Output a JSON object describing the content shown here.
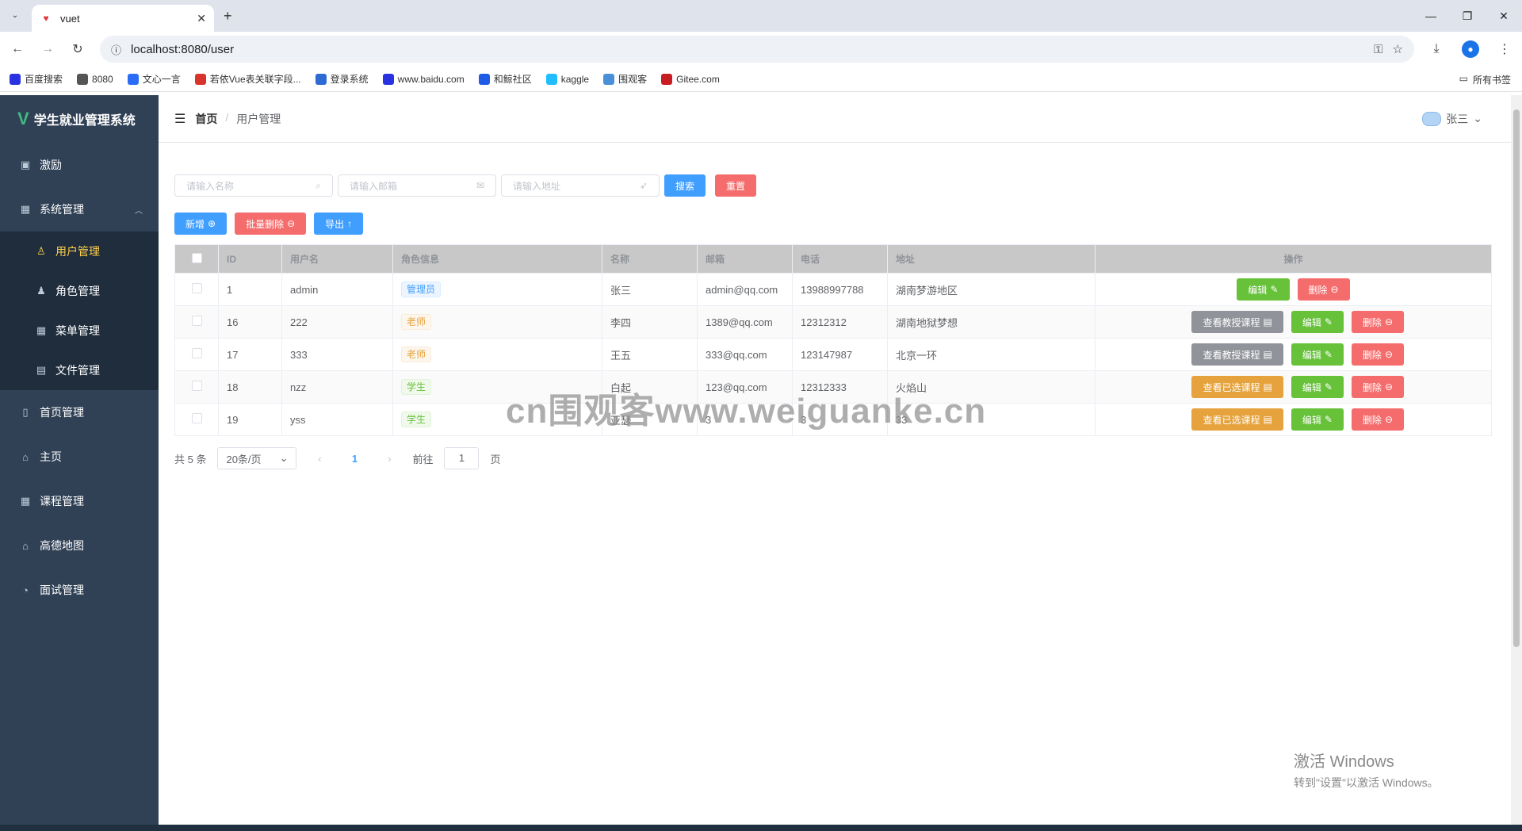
{
  "browser": {
    "tab_title": "vuet",
    "url": "localhost:8080/user",
    "bookmarks": [
      {
        "label": "百度搜索",
        "icon": "baidu-icon",
        "color": "#2932e1"
      },
      {
        "label": "8080",
        "icon": "globe-icon",
        "color": "#555555"
      },
      {
        "label": "文心一言",
        "icon": "wenxin-icon",
        "color": "#2a6cf6"
      },
      {
        "label": "若依Vue表关联字段...",
        "icon": "jian-icon",
        "color": "#d9342b"
      },
      {
        "label": "登录系统",
        "icon": "login-icon",
        "color": "#2d6bd2"
      },
      {
        "label": "www.baidu.com",
        "icon": "baidu-icon",
        "color": "#2932e1"
      },
      {
        "label": "和鲸社区",
        "icon": "heywhale-icon",
        "color": "#1e5ce6"
      },
      {
        "label": "kaggle",
        "icon": "kaggle-icon",
        "color": "#20beff"
      },
      {
        "label": "围观客",
        "icon": "weiguanke-icon",
        "color": "#4a90d9"
      },
      {
        "label": "Gitee.com",
        "icon": "gitee-icon",
        "color": "#c71d23"
      }
    ],
    "all_bookmarks": "所有书签"
  },
  "sidebar": {
    "title": "学生就业管理系统",
    "items": [
      {
        "label": "激励",
        "icon": "chart-icon"
      },
      {
        "label": "系统管理",
        "icon": "grid-icon"
      },
      {
        "label": "用户管理",
        "icon": "user-icon"
      },
      {
        "label": "角色管理",
        "icon": "role-icon"
      },
      {
        "label": "菜单管理",
        "icon": "menu-icon"
      },
      {
        "label": "文件管理",
        "icon": "file-icon"
      },
      {
        "label": "首页管理",
        "icon": "trash-icon"
      },
      {
        "label": "主页",
        "icon": "home-icon"
      },
      {
        "label": "课程管理",
        "icon": "grid-icon"
      },
      {
        "label": "高德地图",
        "icon": "home-icon"
      },
      {
        "label": "面试管理",
        "icon": "trend-icon"
      }
    ]
  },
  "header": {
    "breadcrumb_home": "首页",
    "breadcrumb_current": "用户管理",
    "username": "张三"
  },
  "search": {
    "name_placeholder": "请输入名称",
    "email_placeholder": "请输入邮箱",
    "address_placeholder": "请输入地址",
    "search_label": "搜索",
    "reset_label": "重置"
  },
  "actions": {
    "add_label": "新增",
    "batch_delete_label": "批量删除",
    "export_label": "导出"
  },
  "table": {
    "columns": [
      "ID",
      "用户名",
      "角色信息",
      "名称",
      "邮箱",
      "电话",
      "地址",
      "操作"
    ],
    "rows": [
      {
        "id": "1",
        "username": "admin",
        "role": "管理员",
        "name": "张三",
        "email": "admin@qq.com",
        "phone": "13988997788",
        "address": "湖南梦游地区",
        "course_btn": ""
      },
      {
        "id": "16",
        "username": "222",
        "role": "老师",
        "name": "李四",
        "email": "1389@qq.com",
        "phone": "12312312",
        "address": "湖南地狱梦想",
        "course_btn": "查看教授课程"
      },
      {
        "id": "17",
        "username": "333",
        "role": "老师",
        "name": "王五",
        "email": "333@qq.com",
        "phone": "123147987",
        "address": "北京一环",
        "course_btn": "查看教授课程"
      },
      {
        "id": "18",
        "username": "nzz",
        "role": "学生",
        "name": "白起",
        "email": "123@qq.com",
        "phone": "12312333",
        "address": "火焰山",
        "course_btn": "查看已选课程"
      },
      {
        "id": "19",
        "username": "yss",
        "role": "学生",
        "name": "亚瑟",
        "email": "3",
        "phone": "3",
        "address": "33",
        "course_btn": "查看已选课程"
      }
    ],
    "edit_label": "编辑",
    "delete_label": "删除"
  },
  "pagination": {
    "total": "共 5 条",
    "page_size": "20条/页",
    "current": "1",
    "goto_prefix": "前往",
    "goto_value": "1",
    "goto_suffix": "页"
  },
  "overlay": {
    "watermark": "cn围观客www.weiguanke.cn",
    "activate_title": "激活 Windows",
    "activate_sub": "转到\"设置\"以激活 Windows。"
  }
}
